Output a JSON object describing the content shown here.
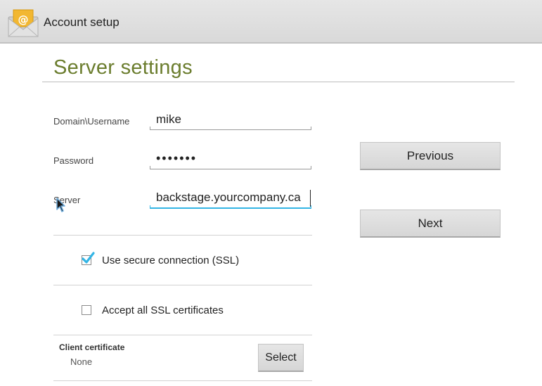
{
  "action_bar": {
    "title": "Account setup",
    "icon": "email-app-icon",
    "accent": "#f2b731"
  },
  "page": {
    "title": "Server settings",
    "title_color": "#6b7d2e"
  },
  "form": {
    "domain_username": {
      "label": "Domain\\Username",
      "value": "mike"
    },
    "password": {
      "label": "Password",
      "value": "•••••••"
    },
    "server": {
      "label": "Server",
      "value": "backstage.yourcompany.ca",
      "focus_color": "#33b5e5"
    }
  },
  "options": {
    "ssl": {
      "label": "Use secure connection (SSL)",
      "checked": true
    },
    "accept_all_ssl": {
      "label": "Accept all SSL certificates",
      "checked": false
    }
  },
  "client_certificate": {
    "label": "Client certificate",
    "value": "None",
    "select_label": "Select"
  },
  "navigation": {
    "previous_label": "Previous",
    "next_label": "Next"
  }
}
